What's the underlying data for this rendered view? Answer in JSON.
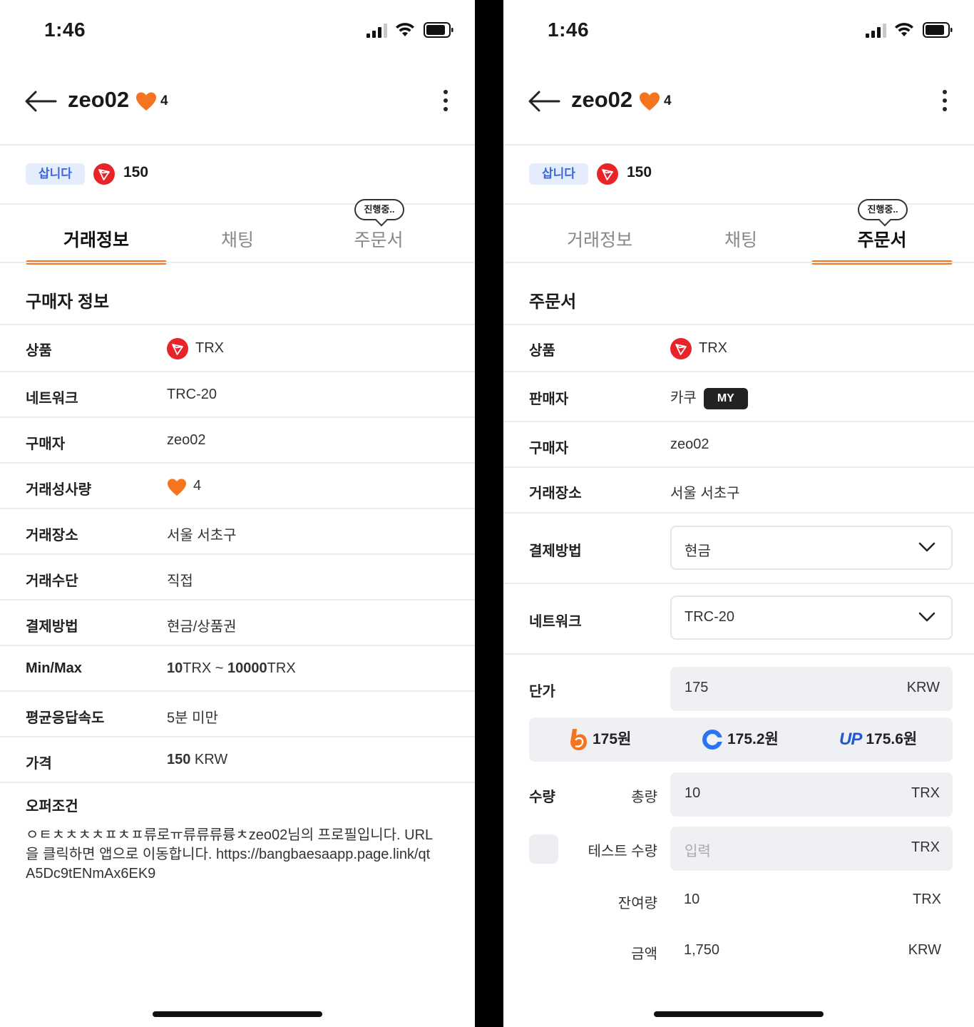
{
  "status": {
    "time": "1:46"
  },
  "header": {
    "username": "zeo02",
    "heart_count": "4"
  },
  "summary": {
    "badge": "삽니다",
    "price": "150"
  },
  "tabs": {
    "info": "거래정보",
    "chat": "채팅",
    "order": "주문서",
    "bubble": "진행중.."
  },
  "left": {
    "section_title": "구매자 정보",
    "rows": {
      "product_label": "상품",
      "product_value": "TRX",
      "network_label": "네트워크",
      "network_value": "TRC-20",
      "buyer_label": "구매자",
      "buyer_value": "zeo02",
      "trades_label": "거래성사량",
      "trades_value": "4",
      "place_label": "거래장소",
      "place_value": "서울 서초구",
      "method_label": "거래수단",
      "method_value": "직접",
      "payment_label": "결제방법",
      "payment_value": "현금/상품권",
      "minmax_label": "Min/Max",
      "min_num": "10",
      "min_unit": "TRX",
      "tilde": " ~ ",
      "max_num": "10000",
      "max_unit": "TRX",
      "speed_label": "평균응답속도",
      "speed_value": "5분 미만",
      "price_label": "가격",
      "price_num": "150",
      "price_unit": " KRW"
    },
    "offer_title": "오퍼조건",
    "offer_text": "ㅇㅌㅊㅊㅊㅊㅍㅊㅍ류로ㅠ류류류륭ㅊzeo02님의 프로필입니다. URL을 클릭하면 앱으로 이동합니다. https://bangbaesaapp.page.link/qtA5Dc9tENmAx6EK9"
  },
  "right": {
    "section_title": "주문서",
    "product_label": "상품",
    "product_value": "TRX",
    "seller_label": "판매자",
    "seller_value": "카쿠",
    "seller_badge": "MY",
    "buyer_label": "구매자",
    "buyer_value": "zeo02",
    "place_label": "거래장소",
    "place_value": "서울 서초구",
    "payment_label": "결제방법",
    "payment_value": "현금",
    "network_label": "네트워크",
    "network_value": "TRC-20",
    "unit_price_label": "단가",
    "unit_price_value": "175",
    "unit_price_currency": "KRW",
    "exchanges": [
      {
        "icon": "bithumb-logo",
        "price": "175원"
      },
      {
        "icon": "coinone-logo",
        "price": "175.2원"
      },
      {
        "icon": "upbit-logo",
        "logo_text": "UP",
        "price": "175.6원"
      }
    ],
    "qty_label": "수량",
    "total_label": "총량",
    "total_value": "10",
    "total_unit": "TRX",
    "test_label": "테스트 수량",
    "test_placeholder": "입력",
    "test_unit": "TRX",
    "remain_label": "잔여량",
    "remain_value": "10",
    "remain_unit": "TRX",
    "amount_label": "금액",
    "amount_value": "1,750",
    "amount_unit": "KRW"
  },
  "colors": {
    "accent": "#f5741f",
    "trx_red": "#e8232a",
    "buy_badge_bg": "#e5edfd",
    "buy_badge_text": "#3b66e0"
  }
}
